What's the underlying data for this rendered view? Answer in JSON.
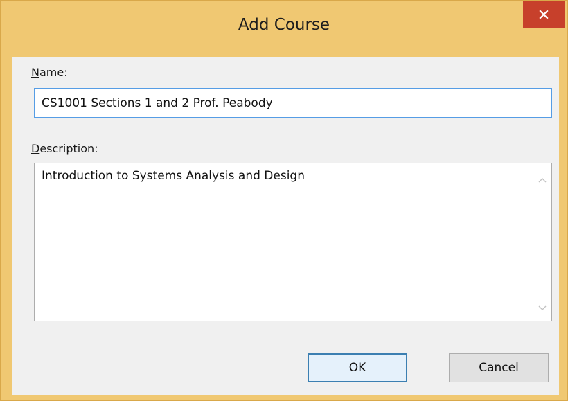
{
  "window": {
    "title": "Add Course"
  },
  "form": {
    "name_label_mnemonic": "N",
    "name_label_rest": "ame:",
    "name_value": "CS1001 Sections 1 and 2 Prof. Peabody",
    "description_label_mnemonic": "D",
    "description_label_rest": "escription:",
    "description_value": "Introduction to Systems Analysis and Design"
  },
  "buttons": {
    "ok_label": "OK",
    "cancel_label": "Cancel"
  },
  "icons": {
    "close": "close-icon",
    "scroll_up": "chevron-up-icon",
    "scroll_down": "chevron-down-icon"
  },
  "colors": {
    "title_bar": "#f0c872",
    "close_button": "#c7402b",
    "focus_border": "#569de5",
    "default_button_border": "#3c7fb1"
  }
}
